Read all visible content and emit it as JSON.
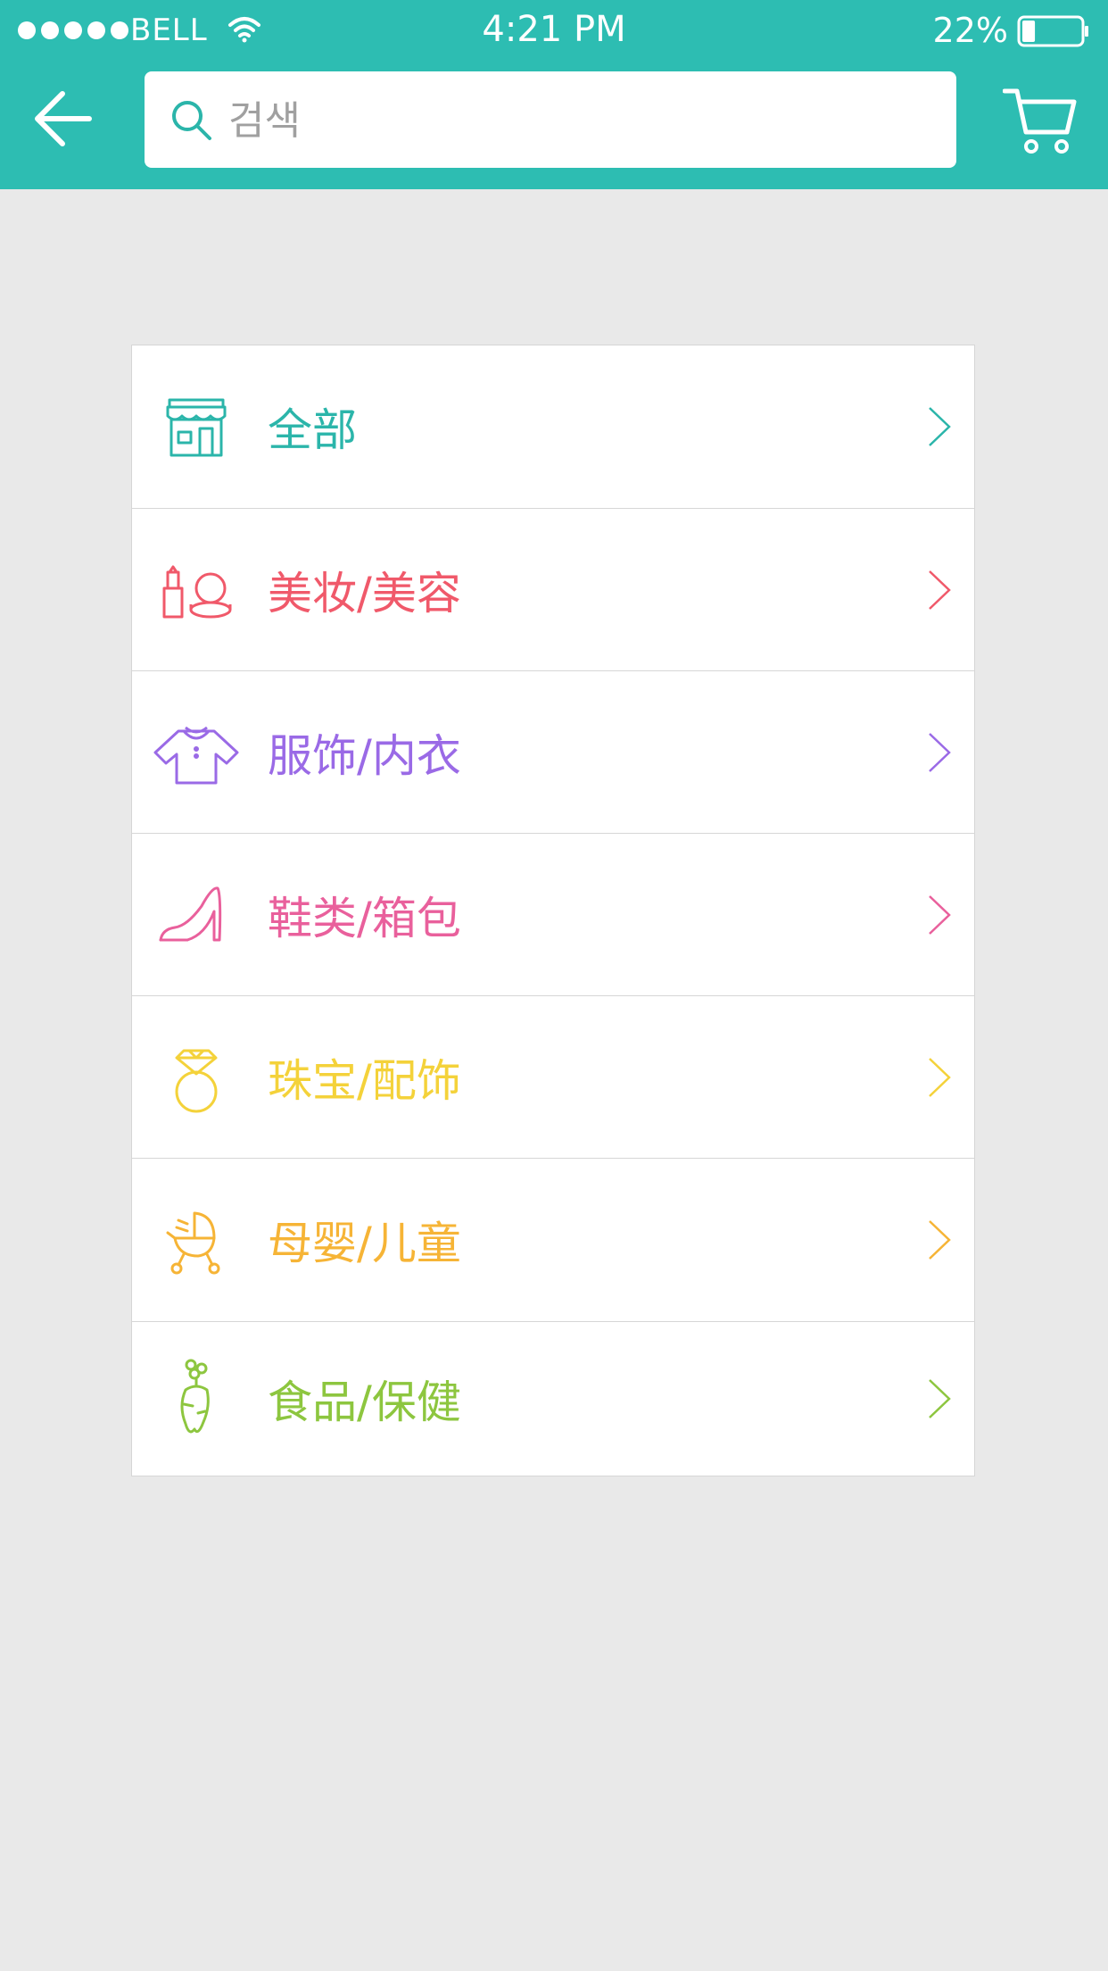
{
  "status_bar": {
    "carrier": "BELL",
    "time": "4:21 PM",
    "battery_pct": "22%",
    "battery_level": 0.22
  },
  "header": {
    "back_icon": "arrow-left-icon",
    "search": {
      "placeholder": "검색",
      "value": ""
    },
    "cart_icon": "shopping-cart-icon",
    "color": "#2dbdb2"
  },
  "categories": [
    {
      "label": "全部",
      "icon": "storefront-icon",
      "color": "#2bb5aa"
    },
    {
      "label": "美妆/美容",
      "icon": "lipstick-compact-icon",
      "color": "#f0596a"
    },
    {
      "label": "服饰/内衣",
      "icon": "shirt-icon",
      "color": "#9a6ae6"
    },
    {
      "label": "鞋类/箱包",
      "icon": "high-heel-icon",
      "color": "#e9609c"
    },
    {
      "label": "珠宝/配饰",
      "icon": "diamond-ring-icon",
      "color": "#f4d23a"
    },
    {
      "label": "母婴/儿童",
      "icon": "baby-stroller-icon",
      "color": "#f6b436"
    },
    {
      "label": "食品/保健",
      "icon": "carrot-icon",
      "color": "#8dc63f"
    }
  ]
}
